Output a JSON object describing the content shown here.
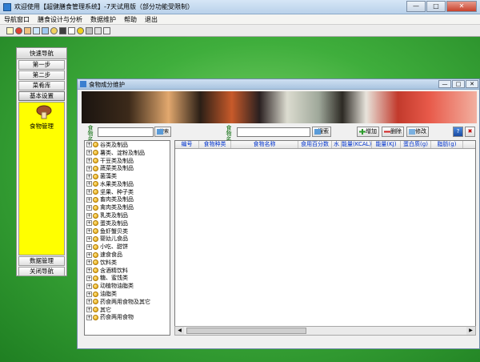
{
  "window": {
    "title": "欢迎使用【超健膳食管理系统】-7天试用版（部分功能受限制）",
    "min_glyph": "—",
    "max_glyph": "□",
    "close_glyph": "✕"
  },
  "menu": [
    "导航窗口",
    "膳食设计与分析",
    "数据维护",
    "帮助",
    "退出"
  ],
  "toolbar_icons": [
    "save-icon",
    "stop-icon",
    "users-icon",
    "chart-icon",
    "monitor-icon",
    "food-icon",
    "book-icon",
    "document-icon",
    "help-icon",
    "tools-icon",
    "print-icon",
    "exit-icon"
  ],
  "nav": {
    "title": "快速导航",
    "buttons": [
      "第一步",
      "第二步",
      "菜肴库",
      "基本设置"
    ],
    "panel_item": "食物管理",
    "bottom_buttons": [
      "数据管理",
      "关闭导航"
    ],
    "panel_color": "#ffff00"
  },
  "child": {
    "title": "食物成分维护",
    "left_label": "食物\n名称",
    "left_button": "搜索",
    "right_label": "食物\n名称",
    "search_button": "搜索",
    "add_button": "增加",
    "delete_button": "删除",
    "edit_button": "修改",
    "help_glyph": "?",
    "close_glyph": "✖"
  },
  "tree": {
    "items": [
      "谷类及制品",
      "薯类、淀粉及制品",
      "干豆类及制品",
      "蔬菜类及制品",
      "菌藻类",
      "水果类及制品",
      "坚果、种子类",
      "畜肉类及制品",
      "禽肉类及制品",
      "乳类及制品",
      "蛋类及制品",
      "鱼虾蟹贝类",
      "婴幼儿食品",
      "小吃、甜饼",
      "速食食品",
      "饮料类",
      "含酒精饮料",
      "糖、蜜饯类",
      "动植物油脂类",
      "油脂类",
      "药食两用食物及其它",
      "其它",
      "药食两用食物"
    ]
  },
  "grid": {
    "columns": [
      "编号",
      "食物种类",
      "食物名称",
      "食用百分数",
      "水",
      "能量(KCAL)",
      "能量(KJ)",
      "蛋白质(g)",
      "脂肪(g)"
    ]
  },
  "scroll": {
    "left": "◀",
    "right": "▶"
  }
}
